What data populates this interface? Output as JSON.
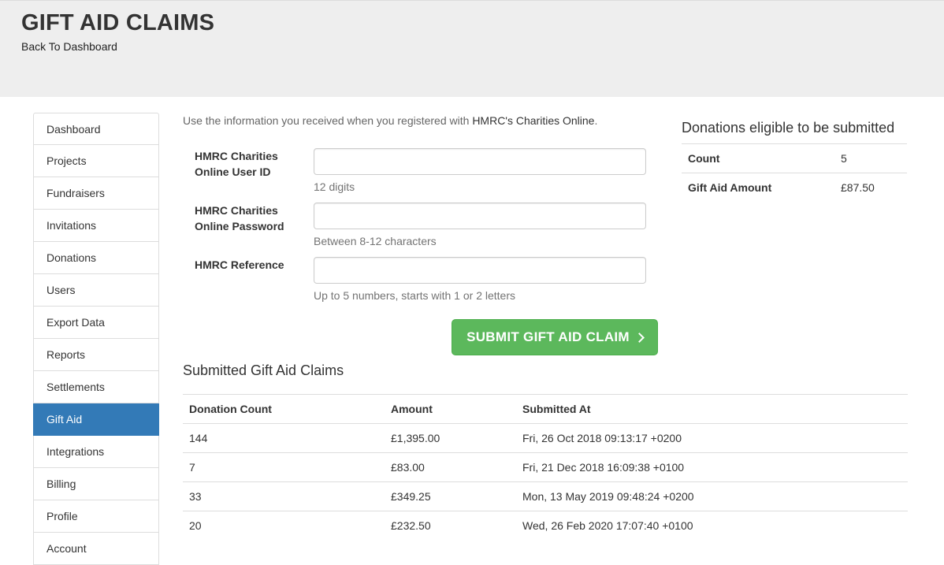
{
  "header": {
    "title": "GIFT AID CLAIMS",
    "back_link": "Back To Dashboard"
  },
  "sidebar": {
    "active": "Gift Aid",
    "items": [
      {
        "label": "Dashboard"
      },
      {
        "label": "Projects"
      },
      {
        "label": "Fundraisers"
      },
      {
        "label": "Invitations"
      },
      {
        "label": "Donations"
      },
      {
        "label": "Users"
      },
      {
        "label": "Export Data"
      },
      {
        "label": "Reports"
      },
      {
        "label": "Settlements"
      },
      {
        "label": "Gift Aid"
      },
      {
        "label": "Integrations"
      },
      {
        "label": "Billing"
      },
      {
        "label": "Profile"
      },
      {
        "label": "Account"
      }
    ]
  },
  "intro": {
    "text": "Use the information you received when you registered with ",
    "link": "HMRC's Charities Online",
    "suffix": "."
  },
  "form": {
    "user_id": {
      "label": "HMRC Charities Online User ID",
      "value": "",
      "help": "12 digits"
    },
    "password": {
      "label": "HMRC Charities Online Password",
      "value": "",
      "help": "Between 8-12 characters"
    },
    "reference": {
      "label": "HMRC Reference",
      "value": "",
      "help": "Up to 5 numbers, starts with 1 or 2 letters"
    },
    "submit_label": "SUBMIT GIFT AID CLAIM"
  },
  "eligible": {
    "title": "Donations eligible to be submitted",
    "rows": [
      {
        "label": "Count",
        "value": "5"
      },
      {
        "label": "Gift Aid Amount",
        "value": "£87.50"
      }
    ]
  },
  "claims": {
    "title": "Submitted Gift Aid Claims",
    "columns": [
      "Donation Count",
      "Amount",
      "Submitted At"
    ],
    "rows": [
      {
        "count": "144",
        "amount": "£1,395.00",
        "submitted_at": "Fri, 26 Oct 2018 09:13:17 +0200"
      },
      {
        "count": "7",
        "amount": "£83.00",
        "submitted_at": "Fri, 21 Dec 2018 16:09:38 +0100"
      },
      {
        "count": "33",
        "amount": "£349.25",
        "submitted_at": "Mon, 13 May 2019 09:48:24 +0200"
      },
      {
        "count": "20",
        "amount": "£232.50",
        "submitted_at": "Wed, 26 Feb 2020 17:07:40 +0100"
      }
    ]
  },
  "colors": {
    "accent": "#337ab7",
    "success": "#5cb85c",
    "header_bg": "#eeeeee"
  }
}
